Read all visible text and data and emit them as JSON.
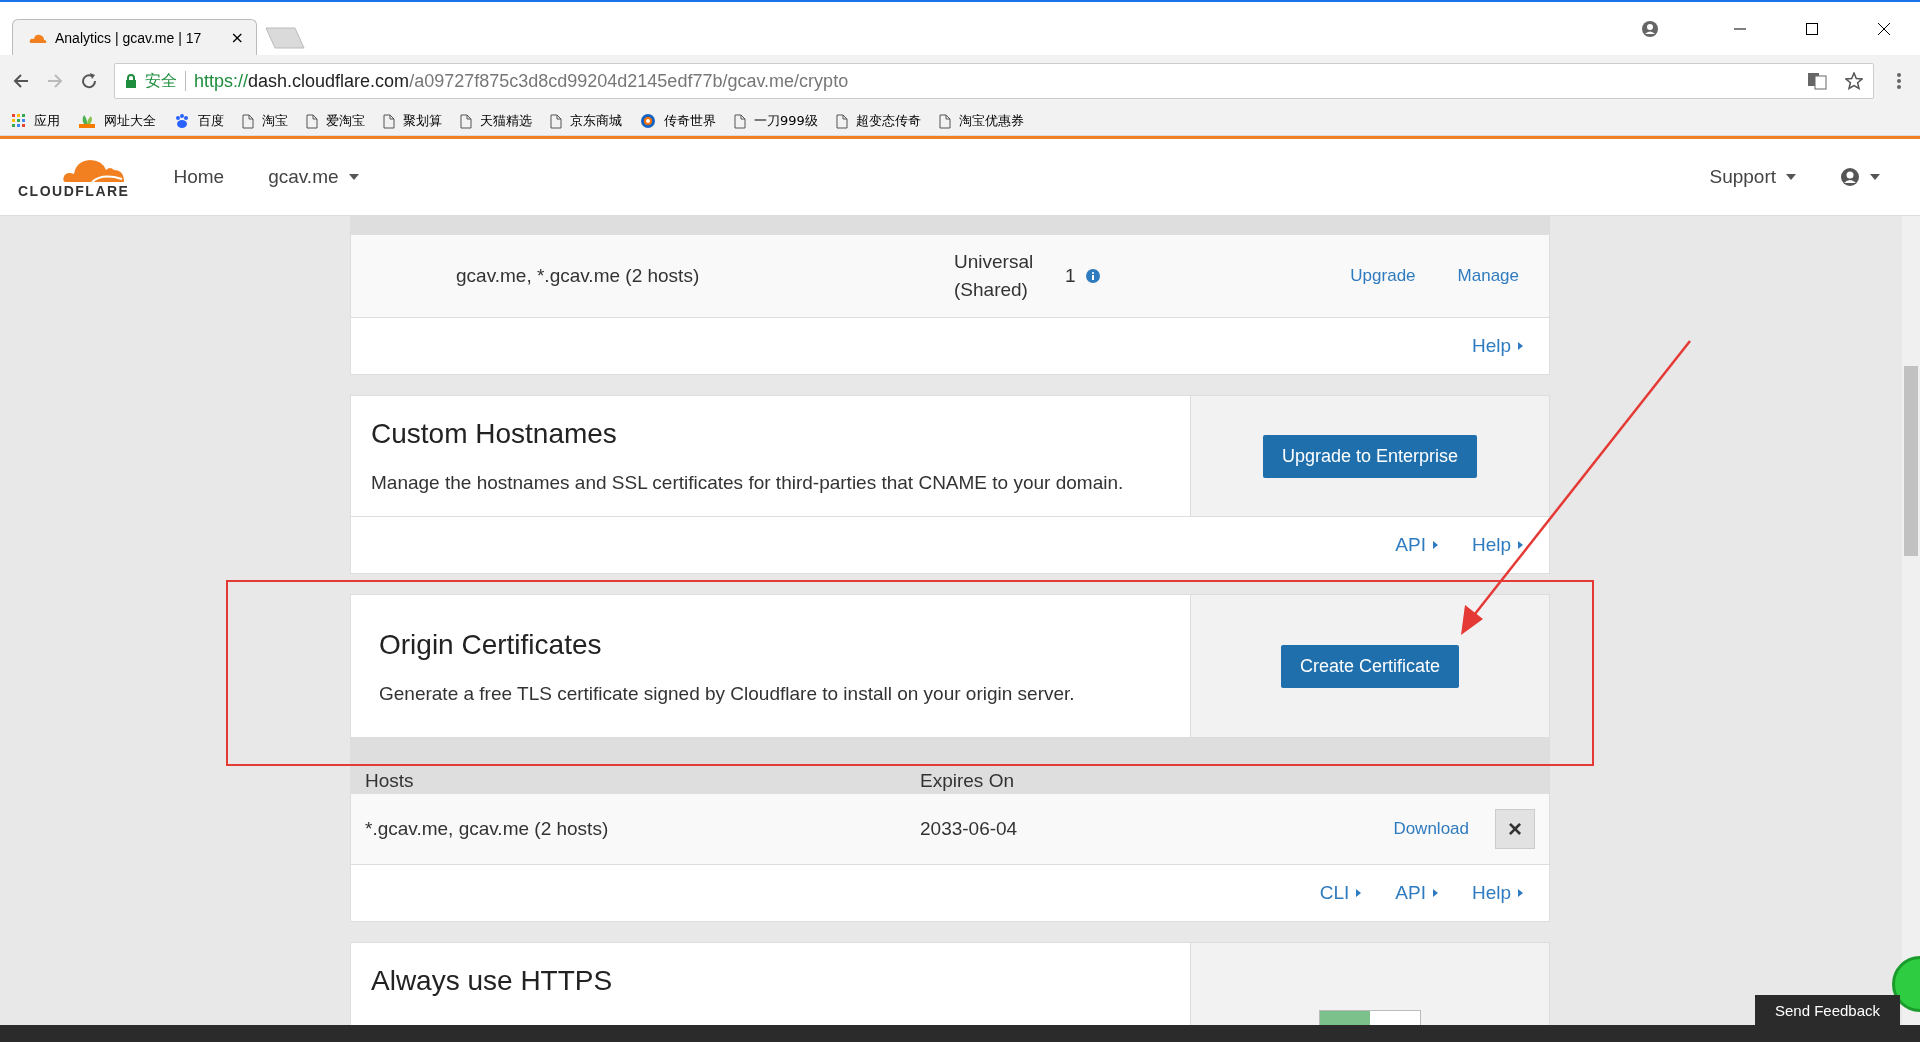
{
  "browser": {
    "tab": {
      "title": "Analytics | gcav.me | 17",
      "close": "×"
    },
    "address": {
      "secure_label": "安全",
      "scheme": "https://",
      "host": "dash.cloudflare.com",
      "path": "/a09727f875c3d8cd99204d2145edf77b/gcav.me/crypto"
    },
    "bookmarks": [
      {
        "kind": "apps",
        "label": "应用"
      },
      {
        "kind": "hao",
        "label": "网址大全"
      },
      {
        "kind": "paw",
        "label": "百度"
      },
      {
        "kind": "page",
        "label": "淘宝"
      },
      {
        "kind": "page",
        "label": "爱淘宝"
      },
      {
        "kind": "page",
        "label": "聚划算"
      },
      {
        "kind": "page",
        "label": "天猫精选"
      },
      {
        "kind": "page",
        "label": "京东商城"
      },
      {
        "kind": "globe",
        "label": "传奇世界"
      },
      {
        "kind": "page",
        "label": "一刀999级"
      },
      {
        "kind": "page",
        "label": "超变态传奇"
      },
      {
        "kind": "page",
        "label": "淘宝优惠券"
      }
    ]
  },
  "header": {
    "logo": "CLOUDFLARE",
    "nav": [
      {
        "label": "Home",
        "dropdown": false
      },
      {
        "label": "gcav.me",
        "dropdown": true
      }
    ],
    "support": "Support"
  },
  "edge_certificates": {
    "row": {
      "hosts": "gcav.me, *.gcav.me (2 hosts)",
      "type": "Universal (Shared)",
      "count": "1",
      "actions": [
        "Upgrade",
        "Manage"
      ]
    },
    "links": [
      "Help"
    ]
  },
  "custom_hostnames": {
    "title": "Custom Hostnames",
    "description": "Manage the hostnames and SSL certificates for third-parties that CNAME to your domain.",
    "button": "Upgrade to Enterprise",
    "links": [
      "API",
      "Help"
    ]
  },
  "origin_certificates": {
    "title": "Origin Certificates",
    "description": "Generate a free TLS certificate signed by Cloudflare to install on your origin server.",
    "button": "Create Certificate",
    "columns": [
      "Hosts",
      "Expires On"
    ],
    "rows": [
      {
        "hosts": "*.gcav.me, gcav.me (2 hosts)",
        "expires": "2033-06-04",
        "action": "Download",
        "remove": "×"
      }
    ],
    "links": [
      "CLI",
      "API",
      "Help"
    ]
  },
  "always_https": {
    "title": "Always use HTTPS",
    "toggle": {
      "on": true
    }
  },
  "feedback": "Send Feedback"
}
